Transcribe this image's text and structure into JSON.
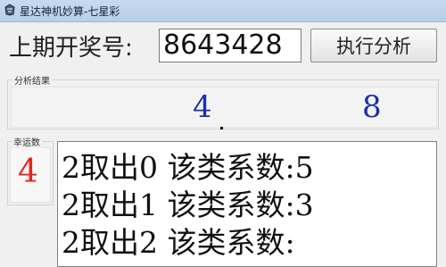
{
  "window": {
    "title": "星达神机妙算-七星彩",
    "icon": "app-icon"
  },
  "top": {
    "period_label": "上期开奖号:",
    "period_value": "8643428",
    "execute_label": "执行分析"
  },
  "analysis": {
    "legend": "分析结果",
    "values": [
      "4",
      "8"
    ],
    "value_color": "#1a2fa8"
  },
  "lucky": {
    "legend": "幸运数",
    "value": "4",
    "value_color": "#e0261d"
  },
  "output": {
    "lines": [
      "2取出0  该类系数:5",
      "2取出1  该类系数:3",
      "2取出2  该类系数:"
    ]
  }
}
